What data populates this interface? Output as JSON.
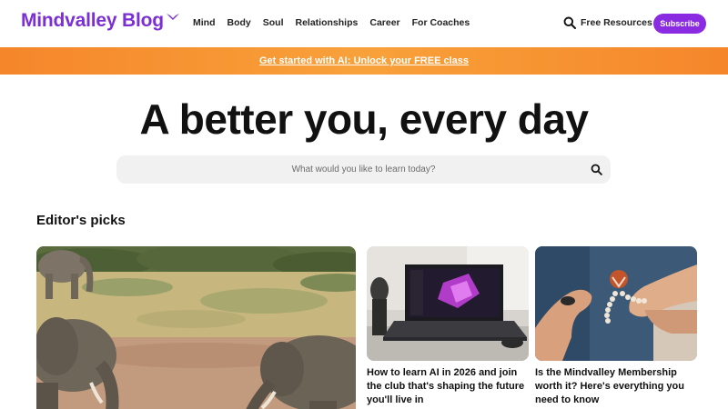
{
  "header": {
    "logo_text": "Mindvalley Blog",
    "nav": [
      "Mind",
      "Body",
      "Soul",
      "Relationships",
      "Career",
      "For Coaches"
    ],
    "search_icon": "search-icon",
    "free_resources": "Free Resources",
    "subscribe": "Subscribe"
  },
  "banner": {
    "link_text": "Get started with AI: Unlock your FREE class"
  },
  "hero": {
    "title": "A better you, every day",
    "search_placeholder": "What would you like to learn today?"
  },
  "picks": {
    "title": "Editor's picks",
    "cards": [
      {
        "caption": ""
      },
      {
        "caption": "How to learn AI in 2026 and join the club that's shaping the future you'll live in"
      },
      {
        "caption": "Is the Mindvalley Membership worth it? Here's everything you need to know"
      }
    ]
  },
  "colors": {
    "brand": "#7b2fd4",
    "subscribe": "#8a2be2",
    "banner": "#f5862a"
  }
}
